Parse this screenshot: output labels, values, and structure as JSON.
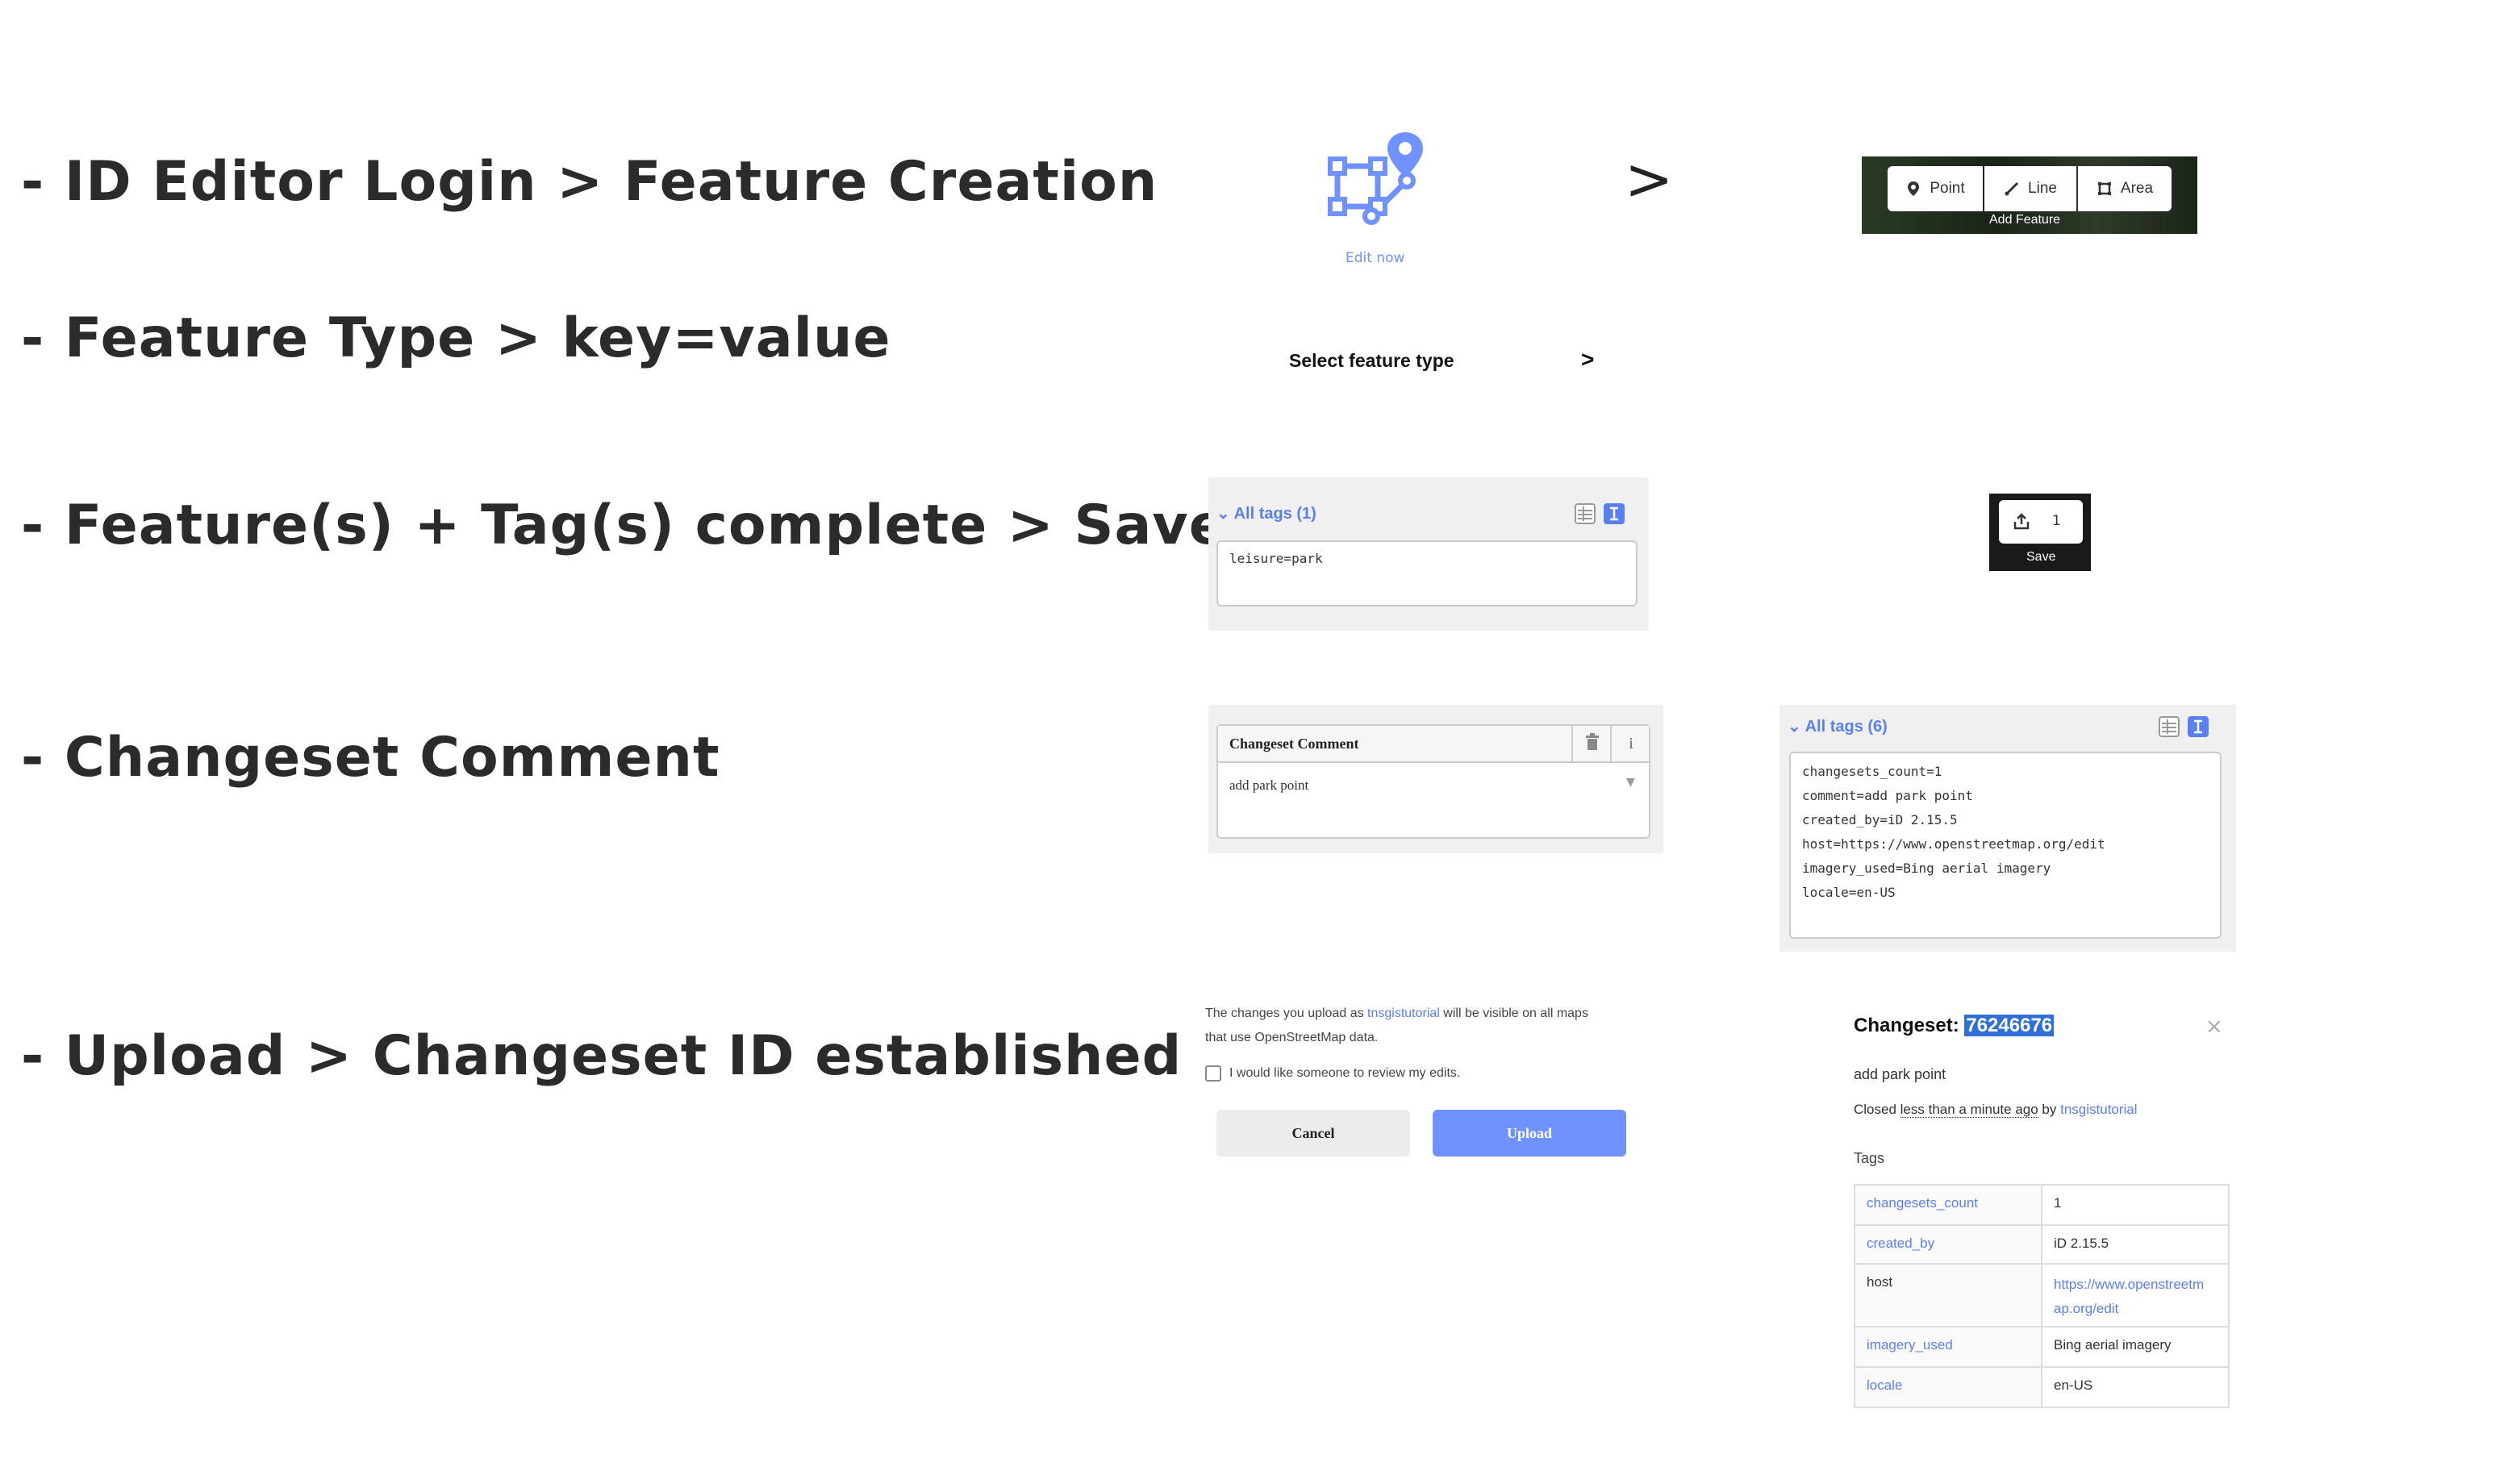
{
  "steps": [
    "- ID Editor Login > Feature Creation",
    "- Feature Type > key=value",
    "- Feature(s) + Tag(s) complete > Save",
    "- Changeset Comment",
    "- Upload > Changeset ID established"
  ],
  "edit_now": {
    "label": "Edit now",
    "icon": "vertex-path-pin-icon"
  },
  "arrow": ">",
  "add_feature": {
    "buttons": [
      {
        "label": "Point",
        "icon": "map-pin-icon"
      },
      {
        "label": "Line",
        "icon": "line-icon"
      },
      {
        "label": "Area",
        "icon": "area-icon"
      }
    ],
    "caption": "Add Feature"
  },
  "select_feature_type": {
    "label": "Select feature type",
    "chevron": ">"
  },
  "all_tags_1": {
    "title": "All tags (1)",
    "text": "leisure=park"
  },
  "save": {
    "count": "1",
    "label": "Save"
  },
  "changeset_comment": {
    "title": "Changeset Comment",
    "value": "add park point"
  },
  "all_tags_6": {
    "title": "All tags (6)",
    "lines": [
      "changesets_count=1",
      "comment=add park point",
      "created_by=iD 2.15.5",
      "host=https://www.openstreetmap.org/edit",
      "imagery_used=Bing aerial imagery",
      "locale=en-US"
    ]
  },
  "upload": {
    "text_before": "The changes you upload as ",
    "user": "tnsgistutorial",
    "text_after": " will be visible on all maps",
    "text_line2": "that use OpenStreetMap data.",
    "review_label": "I would like someone to review my edits.",
    "cancel_label": "Cancel",
    "upload_label": "Upload",
    "accent": "#7092ff"
  },
  "changeset": {
    "title_prefix": "Changeset:",
    "id": "76246676",
    "comment": "add park point",
    "closed_prefix": "Closed ",
    "closed_time": "less than a minute ago",
    "closed_by": " by ",
    "user": "tnsgistutorial",
    "tags_heading": "Tags",
    "close_symbol": "×",
    "tags": [
      {
        "key": "changesets_count",
        "value": "1"
      },
      {
        "key": "created_by",
        "value": "iD 2.15.5"
      },
      {
        "key": "host",
        "value_line1": "https://www.openstreetm",
        "value_line2": "ap.org/edit"
      },
      {
        "key": "imagery_used",
        "value": "Bing aerial imagery"
      },
      {
        "key": "locale",
        "value": "en-US"
      }
    ]
  }
}
